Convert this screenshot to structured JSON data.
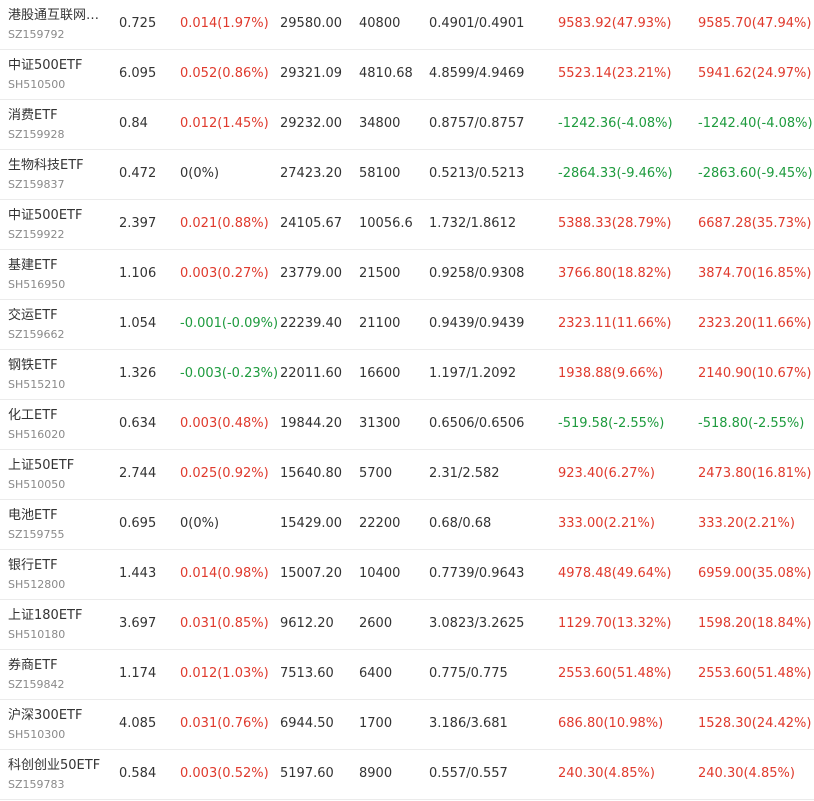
{
  "colors": {
    "up": "#e03a2d",
    "down": "#1e9b3e",
    "flat": "#333333"
  },
  "rows": [
    {
      "name": "港股通互联网…",
      "code": "SZ159792",
      "price": "0.725",
      "change": "0.014(1.97%)",
      "change_dir": "up",
      "amount": "29580.00",
      "shares": "40800",
      "cost": "0.4901/0.4901",
      "profit1": "9583.92(47.93%)",
      "profit1_dir": "up",
      "profit2": "9585.70(47.94%)",
      "profit2_dir": "up"
    },
    {
      "name": "中证500ETF",
      "code": "SH510500",
      "price": "6.095",
      "change": "0.052(0.86%)",
      "change_dir": "up",
      "amount": "29321.09",
      "shares": "4810.68",
      "cost": "4.8599/4.9469",
      "profit1": "5523.14(23.21%)",
      "profit1_dir": "up",
      "profit2": "5941.62(24.97%)",
      "profit2_dir": "up"
    },
    {
      "name": "消费ETF",
      "code": "SZ159928",
      "price": "0.84",
      "change": "0.012(1.45%)",
      "change_dir": "up",
      "amount": "29232.00",
      "shares": "34800",
      "cost": "0.8757/0.8757",
      "profit1": "-1242.36(-4.08%)",
      "profit1_dir": "down",
      "profit2": "-1242.40(-4.08%)",
      "profit2_dir": "down"
    },
    {
      "name": "生物科技ETF",
      "code": "SZ159837",
      "price": "0.472",
      "change": "0(0%)",
      "change_dir": "flat",
      "amount": "27423.20",
      "shares": "58100",
      "cost": "0.5213/0.5213",
      "profit1": "-2864.33(-9.46%)",
      "profit1_dir": "down",
      "profit2": "-2863.60(-9.45%)",
      "profit2_dir": "down"
    },
    {
      "name": "中证500ETF",
      "code": "SZ159922",
      "price": "2.397",
      "change": "0.021(0.88%)",
      "change_dir": "up",
      "amount": "24105.67",
      "shares": "10056.6",
      "cost": "1.732/1.8612",
      "profit1": "5388.33(28.79%)",
      "profit1_dir": "up",
      "profit2": "6687.28(35.73%)",
      "profit2_dir": "up"
    },
    {
      "name": "基建ETF",
      "code": "SH516950",
      "price": "1.106",
      "change": "0.003(0.27%)",
      "change_dir": "up",
      "amount": "23779.00",
      "shares": "21500",
      "cost": "0.9258/0.9308",
      "profit1": "3766.80(18.82%)",
      "profit1_dir": "up",
      "profit2": "3874.70(16.85%)",
      "profit2_dir": "up"
    },
    {
      "name": "交运ETF",
      "code": "SZ159662",
      "price": "1.054",
      "change": "-0.001(-0.09%)",
      "change_dir": "down",
      "amount": "22239.40",
      "shares": "21100",
      "cost": "0.9439/0.9439",
      "profit1": "2323.11(11.66%)",
      "profit1_dir": "up",
      "profit2": "2323.20(11.66%)",
      "profit2_dir": "up"
    },
    {
      "name": "钢铁ETF",
      "code": "SH515210",
      "price": "1.326",
      "change": "-0.003(-0.23%)",
      "change_dir": "down",
      "amount": "22011.60",
      "shares": "16600",
      "cost": "1.197/1.2092",
      "profit1": "1938.88(9.66%)",
      "profit1_dir": "up",
      "profit2": "2140.90(10.67%)",
      "profit2_dir": "up"
    },
    {
      "name": "化工ETF",
      "code": "SH516020",
      "price": "0.634",
      "change": "0.003(0.48%)",
      "change_dir": "up",
      "amount": "19844.20",
      "shares": "31300",
      "cost": "0.6506/0.6506",
      "profit1": "-519.58(-2.55%)",
      "profit1_dir": "down",
      "profit2": "-518.80(-2.55%)",
      "profit2_dir": "down"
    },
    {
      "name": "上证50ETF",
      "code": "SH510050",
      "price": "2.744",
      "change": "0.025(0.92%)",
      "change_dir": "up",
      "amount": "15640.80",
      "shares": "5700",
      "cost": "2.31/2.582",
      "profit1": "923.40(6.27%)",
      "profit1_dir": "up",
      "profit2": "2473.80(16.81%)",
      "profit2_dir": "up"
    },
    {
      "name": "电池ETF",
      "code": "SZ159755",
      "price": "0.695",
      "change": "0(0%)",
      "change_dir": "flat",
      "amount": "15429.00",
      "shares": "22200",
      "cost": "0.68/0.68",
      "profit1": "333.00(2.21%)",
      "profit1_dir": "up",
      "profit2": "333.20(2.21%)",
      "profit2_dir": "up"
    },
    {
      "name": "银行ETF",
      "code": "SH512800",
      "price": "1.443",
      "change": "0.014(0.98%)",
      "change_dir": "up",
      "amount": "15007.20",
      "shares": "10400",
      "cost": "0.7739/0.9643",
      "profit1": "4978.48(49.64%)",
      "profit1_dir": "up",
      "profit2": "6959.00(35.08%)",
      "profit2_dir": "up"
    },
    {
      "name": "上证180ETF",
      "code": "SH510180",
      "price": "3.697",
      "change": "0.031(0.85%)",
      "change_dir": "up",
      "amount": "9612.20",
      "shares": "2600",
      "cost": "3.0823/3.2625",
      "profit1": "1129.70(13.32%)",
      "profit1_dir": "up",
      "profit2": "1598.20(18.84%)",
      "profit2_dir": "up"
    },
    {
      "name": "券商ETF",
      "code": "SZ159842",
      "price": "1.174",
      "change": "0.012(1.03%)",
      "change_dir": "up",
      "amount": "7513.60",
      "shares": "6400",
      "cost": "0.775/0.775",
      "profit1": "2553.60(51.48%)",
      "profit1_dir": "up",
      "profit2": "2553.60(51.48%)",
      "profit2_dir": "up"
    },
    {
      "name": "沪深300ETF",
      "code": "SH510300",
      "price": "4.085",
      "change": "0.031(0.76%)",
      "change_dir": "up",
      "amount": "6944.50",
      "shares": "1700",
      "cost": "3.186/3.681",
      "profit1": "686.80(10.98%)",
      "profit1_dir": "up",
      "profit2": "1528.30(24.42%)",
      "profit2_dir": "up"
    },
    {
      "name": "科创创业50ETF",
      "code": "SZ159783",
      "price": "0.584",
      "change": "0.003(0.52%)",
      "change_dir": "up",
      "amount": "5197.60",
      "shares": "8900",
      "cost": "0.557/0.557",
      "profit1": "240.30(4.85%)",
      "profit1_dir": "up",
      "profit2": "240.30(4.85%)",
      "profit2_dir": "up"
    }
  ]
}
